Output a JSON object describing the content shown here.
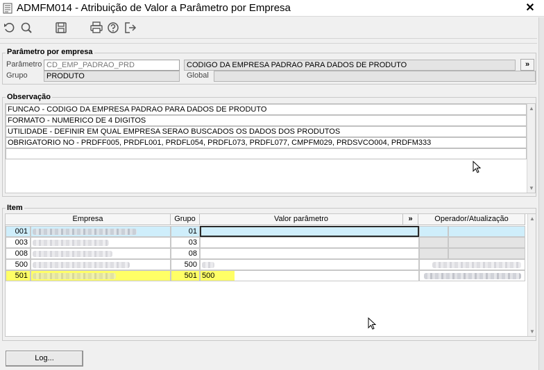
{
  "window": {
    "title": "ADMFM014 - Atribuição de Valor a Parâmetro por Empresa",
    "close": "✕"
  },
  "toolbar": {
    "icons": [
      "undo-icon",
      "search-icon",
      "save-icon",
      "print-icon",
      "help-icon",
      "exit-icon"
    ]
  },
  "param_section": {
    "legend": "Parâmetro por empresa",
    "parametro_label": "Parâmetro",
    "parametro_value": "CD_EMP_PADRAO_PRD",
    "description": "CODIGO DA EMPRESA PADRAO PARA DADOS DE PRODUTO",
    "expand": "»",
    "grupo_label": "Grupo",
    "grupo_value": "PRODUTO",
    "global_label": "Global",
    "global_value": ""
  },
  "observacao": {
    "legend": "Observação",
    "lines": [
      "FUNCAO - CODIGO DA EMPRESA PADRAO PARA DADOS DE PRODUTO",
      "FORMATO - NUMERICO DE 4 DIGITOS",
      "UTILIDADE - DEFINIR EM QUAL EMPRESA SERAO BUSCADOS OS DADOS DOS PRODUTOS",
      "OBRIGATORIO NO - PRDFF005, PRDFL001, PRDFL054, PRDFL073, PRDFL077, CMPFM029, PRDSVCO004, PRDFM333",
      ""
    ]
  },
  "item": {
    "legend": "Item",
    "columns": {
      "empresa": "Empresa",
      "grupo": "Grupo",
      "valor": "Valor parâmetro",
      "expand": "»",
      "operador": "Operador/Atualização"
    },
    "rows": [
      {
        "code": "001",
        "grupo": "01",
        "valor": "",
        "selected": false,
        "active": true
      },
      {
        "code": "003",
        "grupo": "03",
        "valor": "",
        "selected": false,
        "active": false
      },
      {
        "code": "008",
        "grupo": "08",
        "valor": "",
        "selected": false,
        "active": false
      },
      {
        "code": "500",
        "grupo": "500",
        "valor": "",
        "selected": false,
        "active": false
      },
      {
        "code": "501",
        "grupo": "501",
        "valor": "500",
        "selected": true,
        "active": false
      }
    ]
  },
  "colors": {
    "active_row": "#cfeefb",
    "selected_row": "#ffff66"
  },
  "buttons": {
    "log": "Log..."
  }
}
